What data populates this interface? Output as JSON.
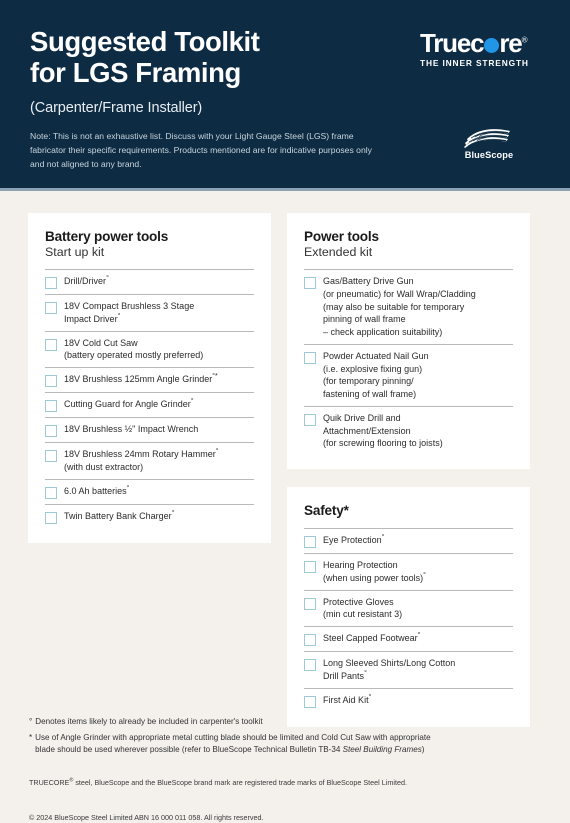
{
  "header": {
    "title": "Suggested Toolkit\nfor LGS Framing",
    "subtitle": "(Carpenter/Frame Installer)",
    "note": "Note: This is not an exhaustive list. Discuss with your Light Gauge Steel (LGS) frame fabricator their specific requirements. Products mentioned are for indicative purposes only and not aligned to any brand.",
    "background_color": "#0d2b42",
    "rule_color": "#8ba3b5",
    "truecore_logo": {
      "name_part1": "Truec",
      "name_part2": "re",
      "registered": "®",
      "tagline": "THE INNER STRENGTH",
      "dot_color": "#2196e8"
    },
    "bluescope_logo": {
      "label": "BlueScope"
    }
  },
  "sections": [
    {
      "id": "battery-power-tools",
      "title": "Battery power tools",
      "subtitle": "Start up kit",
      "items": [
        {
          "label": "Drill/Driver",
          "sup": "°"
        },
        {
          "label": "18V Compact Brushless 3 Stage\nImpact Driver",
          "sup": "°"
        },
        {
          "label": "18V Cold Cut Saw\n(battery operated mostly preferred)",
          "sup": ""
        },
        {
          "label": "18V Brushless 125mm Angle Grinder",
          "sup": "°*"
        },
        {
          "label": "Cutting Guard for Angle Grinder",
          "sup": "°"
        },
        {
          "label": "18V Brushless ½\" Impact Wrench",
          "sup": ""
        },
        {
          "label": "18V Brushless 24mm Rotary Hammer",
          "sup": "°",
          "label_after": "\n(with dust extractor)"
        },
        {
          "label": "6.0 Ah batteries",
          "sup": "°"
        },
        {
          "label": "Twin Battery Bank Charger",
          "sup": "°"
        }
      ]
    },
    {
      "id": "power-tools",
      "title": "Power tools",
      "subtitle": "Extended kit",
      "items": [
        {
          "label": "Gas/Battery Drive Gun\n(or pneumatic) for Wall Wrap/Cladding\n(may also be suitable for temporary\npinning of wall frame\n– check application suitability)",
          "sup": ""
        },
        {
          "label": "Powder Actuated Nail Gun\n(i.e. explosive fixing gun)\n(for temporary pinning/\nfastening of wall frame)",
          "sup": ""
        },
        {
          "label": "Quik Drive Drill and\nAttachment/Extension\n(for screwing flooring to joists)",
          "sup": ""
        }
      ]
    },
    {
      "id": "safety",
      "title": "Safety*",
      "subtitle": "",
      "items": [
        {
          "label": "Eye Protection",
          "sup": "°"
        },
        {
          "label": "Hearing Protection\n(when using power tools)",
          "sup": "°"
        },
        {
          "label": "Protective Gloves\n(min cut resistant 3)",
          "sup": ""
        },
        {
          "label": "Steel Capped Footwear",
          "sup": "°"
        },
        {
          "label": "Long Sleeved Shirts/Long Cotton\nDrill Pants",
          "sup": "°"
        },
        {
          "label": "First Aid Kit",
          "sup": "°"
        }
      ]
    }
  ],
  "footnotes": [
    {
      "marker": "°",
      "text": "Denotes items likely to already be included in carpenter's toolkit",
      "italic_tail": ""
    },
    {
      "marker": "*",
      "text": "Use of Angle Grinder with appropriate metal cutting blade should be limited and Cold Cut Saw with appropriate\nblade should be used wherever possible (refer to BlueScope Technical Bulletin TB-34 ",
      "italic_tail": "Steel Building Frames",
      "tail_close": ")"
    }
  ],
  "legal": {
    "line1_pre": "TRUECORE",
    "line1_sup": "®",
    "line1_post": " steel, BlueScope and the BlueScope brand mark are registered trade marks of BlueScope Steel Limited.",
    "line2": "© 2024 BlueScope Steel Limited ABN 16 000 011 058. All rights reserved."
  }
}
